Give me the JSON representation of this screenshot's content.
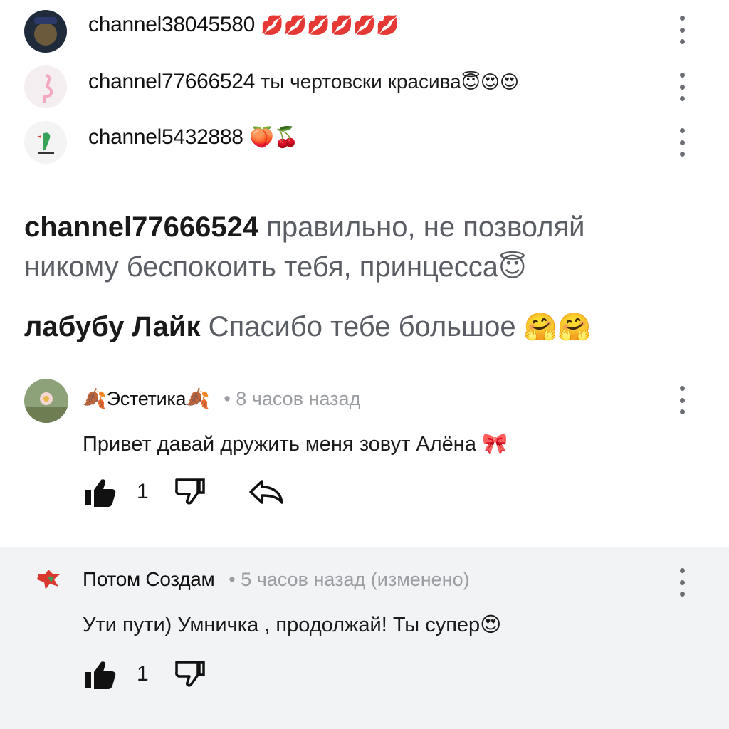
{
  "top_comments": [
    {
      "username": "channel38045580",
      "text": "",
      "emoji": "💋💋💋💋💋💋"
    },
    {
      "username": "channel77666524",
      "text": "ты чертовски красива",
      "emoji": "😇😍😍"
    },
    {
      "username": "channel5432888",
      "text": "",
      "emoji": "🍑🍒"
    }
  ],
  "big_replies": [
    {
      "username": "channel77666524",
      "text_line1": "правильно, не позволяй",
      "text_line2": "никому беспокоить тебя, принцесса",
      "emoji": "😇"
    },
    {
      "username": "лабубу Лайк",
      "text": "Спасибо тебе большое",
      "emoji": "🤗🤗"
    }
  ],
  "comment1": {
    "leaf_emoji": "🍂",
    "username": "Эстетика",
    "time": "• 8 часов назад",
    "text": "Привет давай дружить меня зовут Алёна",
    "emoji": "🎀",
    "likes": "1"
  },
  "comment2": {
    "username": "Потом Создам",
    "time": "• 5 часов назад (изменено)",
    "text": "Ути пути) Умничка , продолжай! Ты супер",
    "emoji": "😍",
    "likes": "1"
  },
  "colors": {
    "text": "#1a1a1a",
    "muted": "#9a9da2",
    "highlight_bg": "#f2f3f5"
  }
}
